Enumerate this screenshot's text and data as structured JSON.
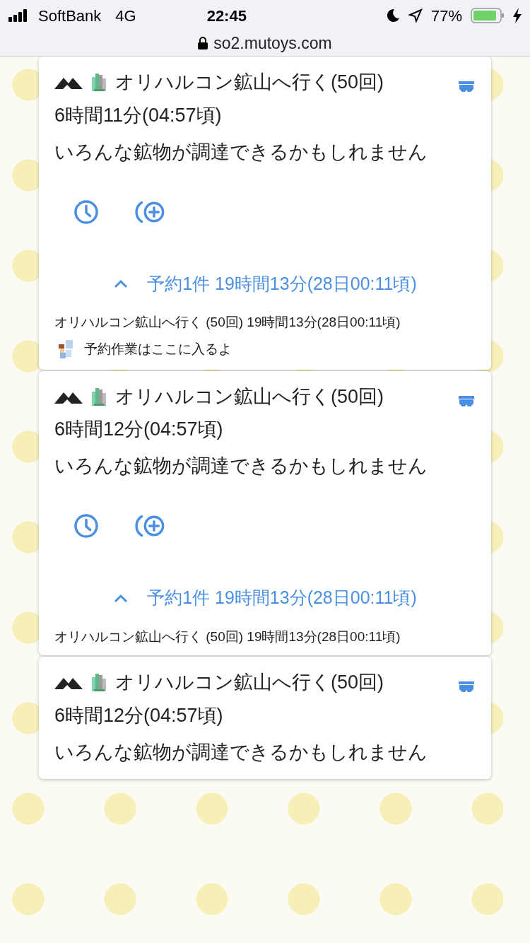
{
  "status_bar": {
    "carrier": "SoftBank",
    "network": "4G",
    "time": "22:45",
    "battery": "77%",
    "url": "so2.mutoys.com"
  },
  "cards": [
    {
      "title": "オリハルコン鉱山へ行く(50回)",
      "duration": "6時間11分(04:57頃)",
      "description": "いろんな鉱物が調達できるかもしれません",
      "reservation": {
        "summary": "予約1件 19時間13分(28日00:11頃)",
        "expanded": true,
        "items": [
          "オリハルコン鉱山へ行く (50回) 19時間13分(28日00:11頃)"
        ]
      },
      "note": "予約作業はここに入るよ"
    },
    {
      "title": "オリハルコン鉱山へ行く(50回)",
      "duration": "6時間12分(04:57頃)",
      "description": "いろんな鉱物が調達できるかもしれません",
      "reservation": {
        "summary": "予約1件 19時間13分(28日00:11頃)",
        "expanded": true,
        "items": [
          "オリハルコン鉱山へ行く (50回) 19時間13分(28日00:11頃)"
        ]
      }
    },
    {
      "title": "オリハルコン鉱山へ行く(50回)",
      "duration": "6時間12分(04:57頃)",
      "description": "いろんな鉱物が調達できるかもしれません"
    }
  ]
}
